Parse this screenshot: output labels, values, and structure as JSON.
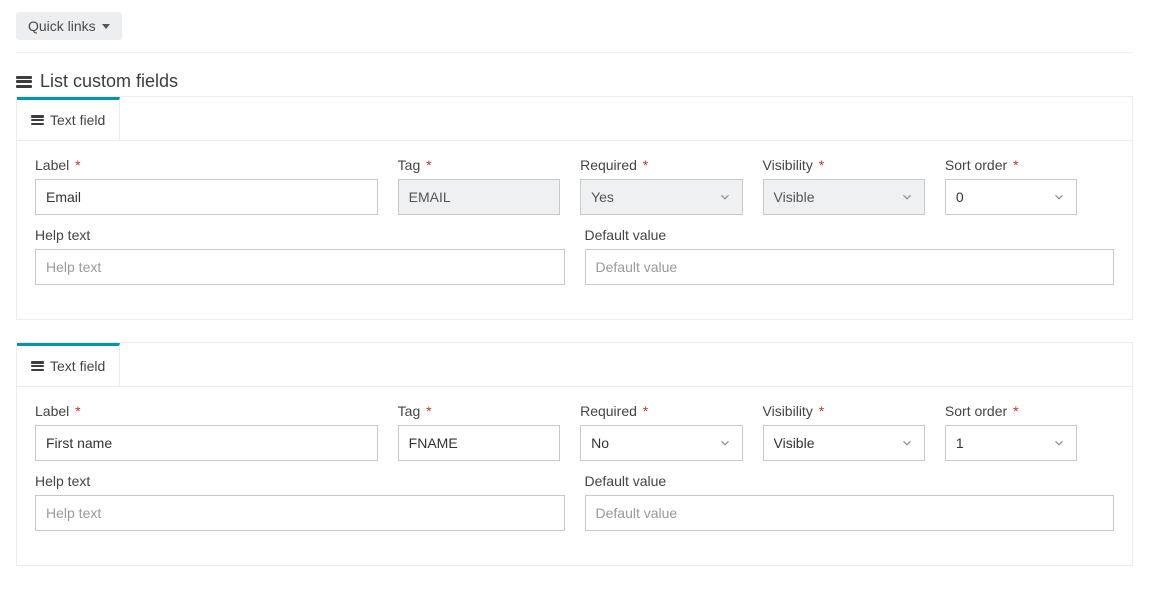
{
  "quicklinks": {
    "label": "Quick links"
  },
  "section": {
    "title": "List custom fields"
  },
  "tab_label": "Text field",
  "labels": {
    "label": "Label",
    "tag": "Tag",
    "required": "Required",
    "visibility": "Visibility",
    "sort_order": "Sort order",
    "help_text": "Help text",
    "default_value": "Default value"
  },
  "placeholders": {
    "help_text": "Help text",
    "default_value": "Default value"
  },
  "fields": [
    {
      "label": "Email",
      "tag": "EMAIL",
      "tag_disabled": true,
      "required": "Yes",
      "required_disabled": true,
      "visibility": "Visible",
      "visibility_disabled": true,
      "sort_order": "0",
      "help_text": "",
      "default_value": ""
    },
    {
      "label": "First name",
      "tag": "FNAME",
      "tag_disabled": false,
      "required": "No",
      "required_disabled": false,
      "visibility": "Visible",
      "visibility_disabled": false,
      "sort_order": "1",
      "help_text": "",
      "default_value": ""
    }
  ]
}
